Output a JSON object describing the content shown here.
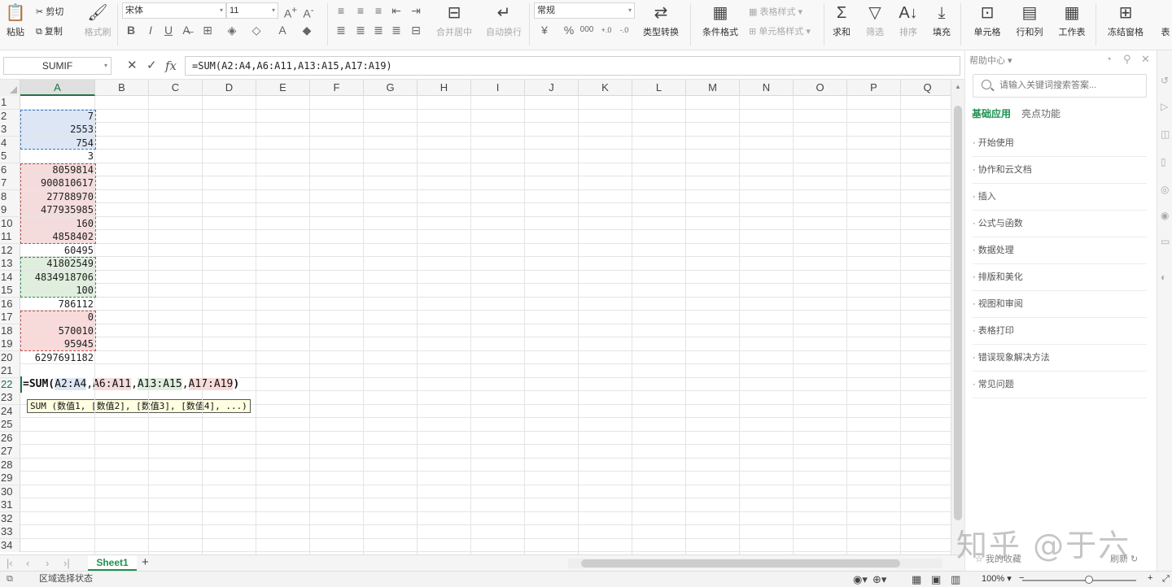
{
  "ribbon": {
    "paste": "粘贴",
    "cut": "剪切",
    "copy": "复制",
    "format_painter": "格式刷",
    "font_name": "宋体",
    "font_size": "11",
    "merge_center": "合并居中",
    "wrap_text": "自动换行",
    "number_format": "常规",
    "type_convert": "类型转换",
    "conditional_format": "条件格式",
    "table_style": "表格样式",
    "cell_style": "单元格样式",
    "sum": "求和",
    "filter": "筛选",
    "sort": "排序",
    "fill": "填充",
    "cell": "单元格",
    "row_col": "行和列",
    "worksheet": "工作表",
    "freeze": "冻结窗格",
    "more": "表"
  },
  "formula_bar": {
    "name_box": "SUMIF",
    "cancel": "✕",
    "confirm": "✓",
    "fx": "fx",
    "formula": "=SUM(A2:A4,A6:A11,A13:A15,A17:A19)"
  },
  "columns": [
    "A",
    "B",
    "C",
    "D",
    "E",
    "F",
    "G",
    "H",
    "I",
    "J",
    "K",
    "L",
    "M",
    "N",
    "O",
    "P",
    "Q"
  ],
  "rows": [
    "1",
    "2",
    "3",
    "4",
    "5",
    "6",
    "7",
    "8",
    "9",
    "10",
    "11",
    "12",
    "13",
    "14",
    "15",
    "16",
    "17",
    "18",
    "19",
    "20",
    "21",
    "22",
    "23",
    "24",
    "25",
    "26",
    "27",
    "28",
    "29",
    "30",
    "31",
    "32",
    "33",
    "34"
  ],
  "cells_A": [
    "",
    "7",
    "2553",
    "754",
    "3",
    "8059814",
    "900810617",
    "27788970",
    "477935985",
    "160",
    "4858402",
    "60495",
    "41802549",
    "4834918706",
    "100",
    "786112",
    "0",
    "570010",
    "95945",
    "6297691182",
    "",
    "",
    "",
    "",
    "",
    "",
    "",
    "",
    "",
    "",
    "",
    "",
    "",
    ""
  ],
  "range_colors": {
    "r1": "#dce6f5",
    "r2": "#f5dcdc",
    "r3": "#dfeedd",
    "r4": "#f9dada",
    "border1": "#3b79c4",
    "border2": "#c0504d",
    "border3": "#2e8b57",
    "border4": "#c0504d",
    "accent": "#217346"
  },
  "edit_cell": {
    "prefix": "=SUM(",
    "ref1": "A2:A4",
    "sep1": ",",
    "ref2": "A6:A11",
    "sep2": ",",
    "ref3": "A13:A15",
    "sep3": ",",
    "ref4": "A17:A19",
    "suffix": ")"
  },
  "tooltip": "SUM (数值1, [数值2], [数值3], [数值4], ...)",
  "sheet_tabs": {
    "active": "Sheet1",
    "add": "+"
  },
  "help_panel": {
    "title": "帮助中心",
    "search_placeholder": "请输入关键词搜索答案...",
    "tab_basic": "基础应用",
    "tab_highlight": "亮点功能",
    "items": [
      "开始使用",
      "协作和云文档",
      "插入",
      "公式与函数",
      "数据处理",
      "排版和美化",
      "视图和审阅",
      "表格打印",
      "错误现象解决方法",
      "常见问题"
    ],
    "favorites": "我的收藏",
    "refresh": "刷新"
  },
  "status_bar": {
    "mode": "区域选择状态",
    "zoom": "100%"
  },
  "watermark": "知乎 @于六"
}
